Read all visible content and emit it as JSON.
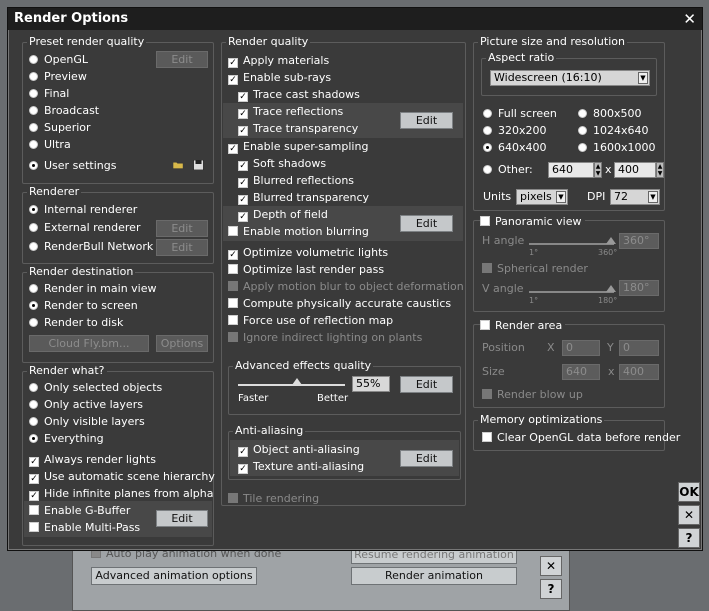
{
  "bg_window": {
    "autoplay_label": "Auto play animation when done",
    "resume_label": "Resume rendering animation",
    "adv_anim_label": "Advanced animation options",
    "render_anim_label": "Render animation",
    "close": "✕",
    "help": "?"
  },
  "dialog": {
    "title": "Render Options",
    "close": "✕"
  },
  "preset": {
    "label": "Preset render quality",
    "options": [
      "OpenGL",
      "Preview",
      "Final",
      "Broadcast",
      "Superior",
      "Ultra",
      "User settings"
    ],
    "selected": "User settings",
    "edit": "Edit"
  },
  "renderer": {
    "label": "Renderer",
    "options": [
      "Internal renderer",
      "External renderer",
      "RenderBull Network"
    ],
    "selected": "Internal renderer",
    "edit": "Edit"
  },
  "destination": {
    "label": "Render destination",
    "options": [
      "Render in main view",
      "Render to screen",
      "Render to disk"
    ],
    "selected": "Render to screen",
    "cloud": "Cloud Fly.bm...",
    "options_btn": "Options"
  },
  "render_what": {
    "label": "Render what?",
    "options": [
      "Only selected objects",
      "Only active layers",
      "Only visible layers",
      "Everything"
    ],
    "selected": "Everything",
    "checks": [
      {
        "label": "Always render lights",
        "checked": true
      },
      {
        "label": "Use automatic scene hierarchy",
        "checked": true
      },
      {
        "label": "Hide infinite planes from alpha",
        "checked": true
      },
      {
        "label": "Enable G-Buffer",
        "checked": false
      },
      {
        "label": "Enable Multi-Pass",
        "checked": false
      }
    ],
    "edit": "Edit"
  },
  "quality": {
    "label": "Render quality",
    "apply_materials": "Apply materials",
    "sub_rays": "Enable sub-rays",
    "trace_cast": "Trace cast shadows",
    "trace_refl": "Trace reflections",
    "trace_transp": "Trace transparency",
    "super_sampling": "Enable super-sampling",
    "soft_shadows": "Soft shadows",
    "blurred_refl": "Blurred reflections",
    "blurred_transp": "Blurred transparency",
    "dof": "Depth of field",
    "motion_blur": "Enable motion blurring",
    "vol_lights": "Optimize volumetric lights",
    "last_pass": "Optimize last render pass",
    "motion_deform": "Apply motion blur to object deformation",
    "caustics": "Compute physically accurate caustics",
    "force_refl": "Force use of reflection map",
    "indirect": "Ignore indirect lighting on plants",
    "edit": "Edit"
  },
  "advanced": {
    "label": "Advanced effects quality",
    "value": "55%",
    "faster": "Faster",
    "better": "Better",
    "edit": "Edit",
    "level": 0.55
  },
  "antialias": {
    "label": "Anti-aliasing",
    "object": "Object anti-aliasing",
    "texture": "Texture anti-aliasing",
    "edit": "Edit"
  },
  "tile": "Tile rendering",
  "picture": {
    "label": "Picture size and resolution",
    "aspect_label": "Aspect ratio",
    "aspect_value": "Widescreen (16:10)",
    "sizes": [
      "Full screen",
      "800x500",
      "320x200",
      "1024x640",
      "640x400",
      "1600x1000"
    ],
    "selected": "640x400",
    "other": "Other:",
    "w": "640",
    "x": "x",
    "h": "400",
    "units_label": "Units",
    "units": "pixels",
    "dpi_label": "DPI",
    "dpi": "72"
  },
  "panoramic": {
    "label": "Panoramic view",
    "h_angle": "H angle",
    "h_value": "360°",
    "h_min": "1°",
    "h_max": "360°",
    "spherical": "Spherical render",
    "v_angle": "V angle",
    "v_value": "180°",
    "v_min": "1°",
    "v_max": "180°"
  },
  "area": {
    "label": "Render area",
    "position": "Position",
    "x_lbl": "X",
    "x": "0",
    "y_lbl": "Y",
    "y": "0",
    "size": "Size",
    "w": "640",
    "sep": "x",
    "h": "400",
    "blowup": "Render blow up"
  },
  "memory": {
    "label": "Memory optimizations",
    "clear": "Clear OpenGL data before render"
  },
  "side": {
    "ok": "OK",
    "cancel": "✕",
    "help": "?"
  }
}
